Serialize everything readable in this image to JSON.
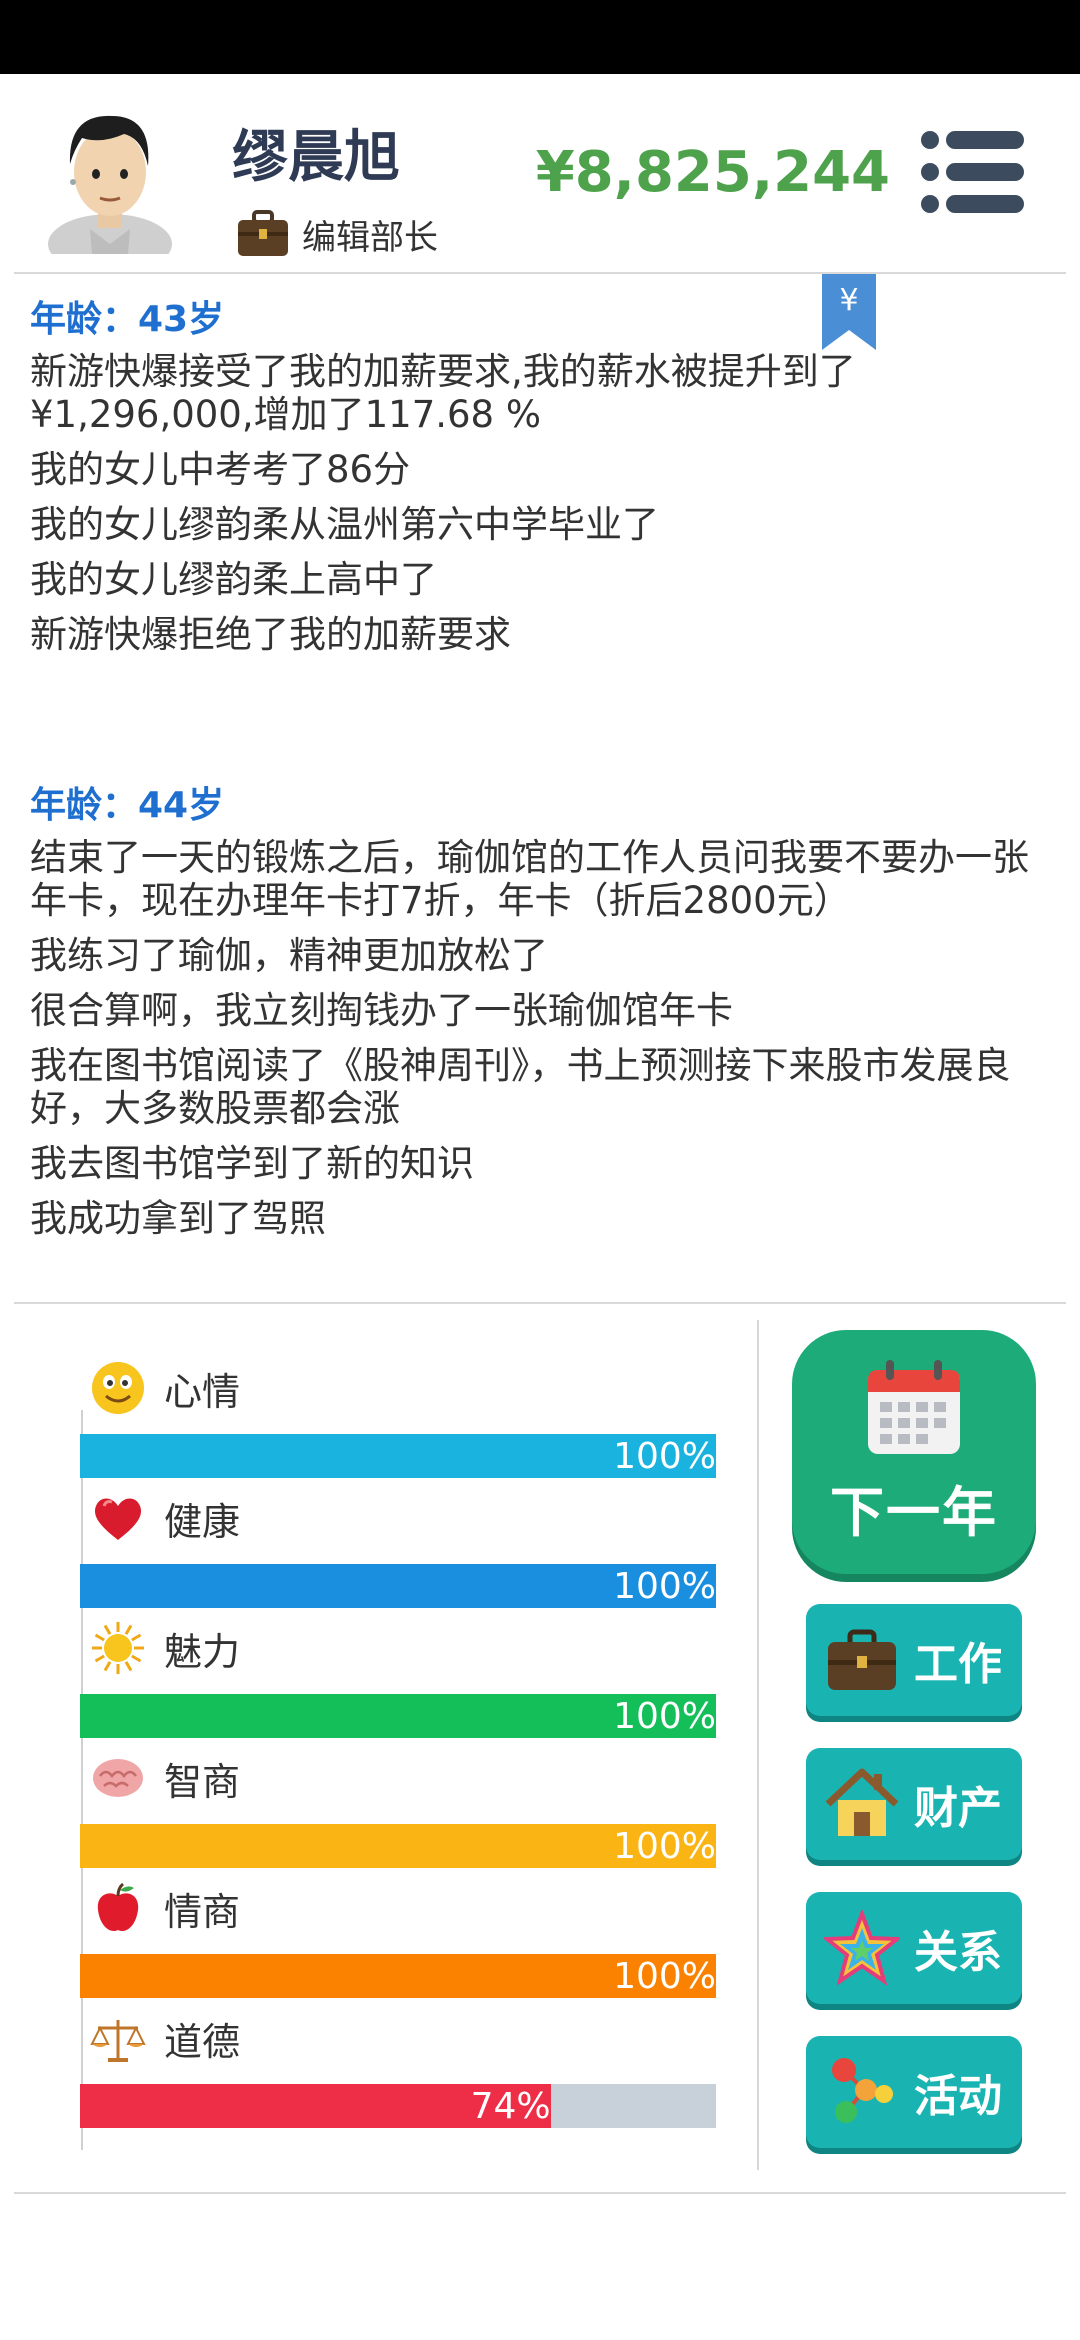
{
  "header": {
    "name": "缪晨旭",
    "job_title": "编辑部长",
    "money": "¥8,825,244"
  },
  "log": [
    {
      "age": "年龄：43岁",
      "entries": [
        "新游快爆接受了我的加薪要求,我的薪水被提升到了¥1,296,000,增加了117.68 %",
        "我的女儿中考考了86分",
        "我的女儿缪韵柔从温州第六中学毕业了",
        "我的女儿缪韵柔上高中了",
        "新游快爆拒绝了我的加薪要求"
      ]
    },
    {
      "age": "年龄：44岁",
      "entries": [
        "结束了一天的锻炼之后，瑜伽馆的工作人员问我要不要办一张年卡，现在办理年卡打7折，年卡（折后2800元）",
        "我练习了瑜伽，精神更加放松了",
        "很合算啊，我立刻掏钱办了一张瑜伽馆年卡",
        "我在图书馆阅读了《股神周刊》，书上预测接下来股市发展良好，大多数股票都会涨",
        "我去图书馆学到了新的知识",
        "我成功拿到了驾照"
      ]
    }
  ],
  "bookmark_symbol": "¥",
  "stats": [
    {
      "key": "mood",
      "label": "心情",
      "value": 100,
      "display": "100%",
      "color": "#1ab3e0",
      "icon": "smiley-icon"
    },
    {
      "key": "health",
      "label": "健康",
      "value": 100,
      "display": "100%",
      "color": "#1a8fe0",
      "icon": "heart-icon"
    },
    {
      "key": "charm",
      "label": "魅力",
      "value": 100,
      "display": "100%",
      "color": "#14bf5a",
      "icon": "sun-icon"
    },
    {
      "key": "iq",
      "label": "智商",
      "value": 100,
      "display": "100%",
      "color": "#fab414",
      "icon": "brain-icon"
    },
    {
      "key": "eq",
      "label": "情商",
      "value": 100,
      "display": "100%",
      "color": "#fb8200",
      "icon": "apple-icon"
    },
    {
      "key": "morality",
      "label": "道德",
      "value": 74,
      "display": "74%",
      "color": "#ee2d47",
      "icon": "scales-icon"
    }
  ],
  "actions": {
    "next_year": "下一年",
    "work": "工作",
    "property": "财产",
    "relations": "关系",
    "activities": "活动"
  }
}
